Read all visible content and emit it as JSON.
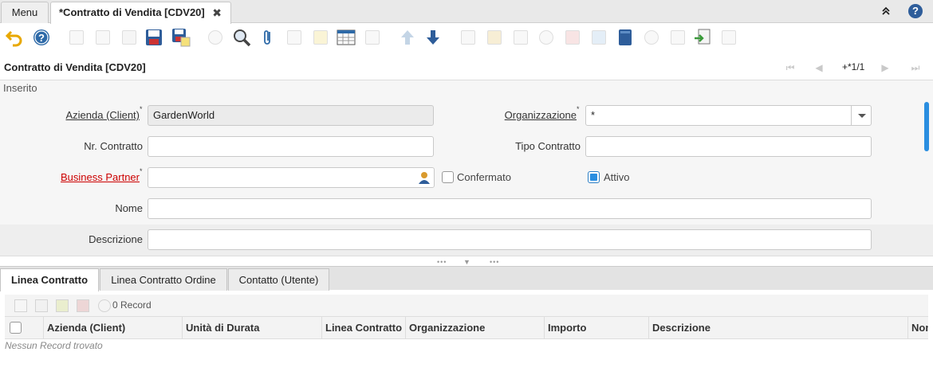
{
  "tabs": {
    "menu_label": "Menu",
    "window_label": "*Contratto di Vendita [CDV20]",
    "close_symbol": "✖"
  },
  "header": {
    "title": "Contratto di Vendita [CDV20]",
    "record_nav": "+*1/1",
    "status": "Inserito"
  },
  "form": {
    "client_label": "Azienda (Client)",
    "client_value": "GardenWorld",
    "org_label": "Organizzazione",
    "org_value": "*",
    "contract_no_label": "Nr. Contratto",
    "contract_no_value": "",
    "contract_type_label": "Tipo Contratto",
    "contract_type_value": "",
    "bpartner_label": "Business Partner",
    "bpartner_value": "",
    "confirmed_label": "Confermato",
    "confirmed": false,
    "active_label": "Attivo",
    "active": true,
    "name_label": "Nome",
    "name_value": "",
    "description_label": "Descrizione",
    "description_value": "",
    "required_mark": "*"
  },
  "detail": {
    "tabs": [
      "Linea Contratto",
      "Linea Contratto Ordine",
      "Contatto (Utente)"
    ],
    "records": "0 Record",
    "columns": [
      "Azienda (Client)",
      "Unità di Durata",
      "Linea Contratto",
      "Organizzazione",
      "Importo",
      "Descrizione",
      "Nom"
    ],
    "empty_text": "Nessun Record trovato"
  },
  "colors": {
    "accent": "#2a8ee0",
    "required_label": "#cc0000",
    "help_icon": "#2e5d9a"
  }
}
